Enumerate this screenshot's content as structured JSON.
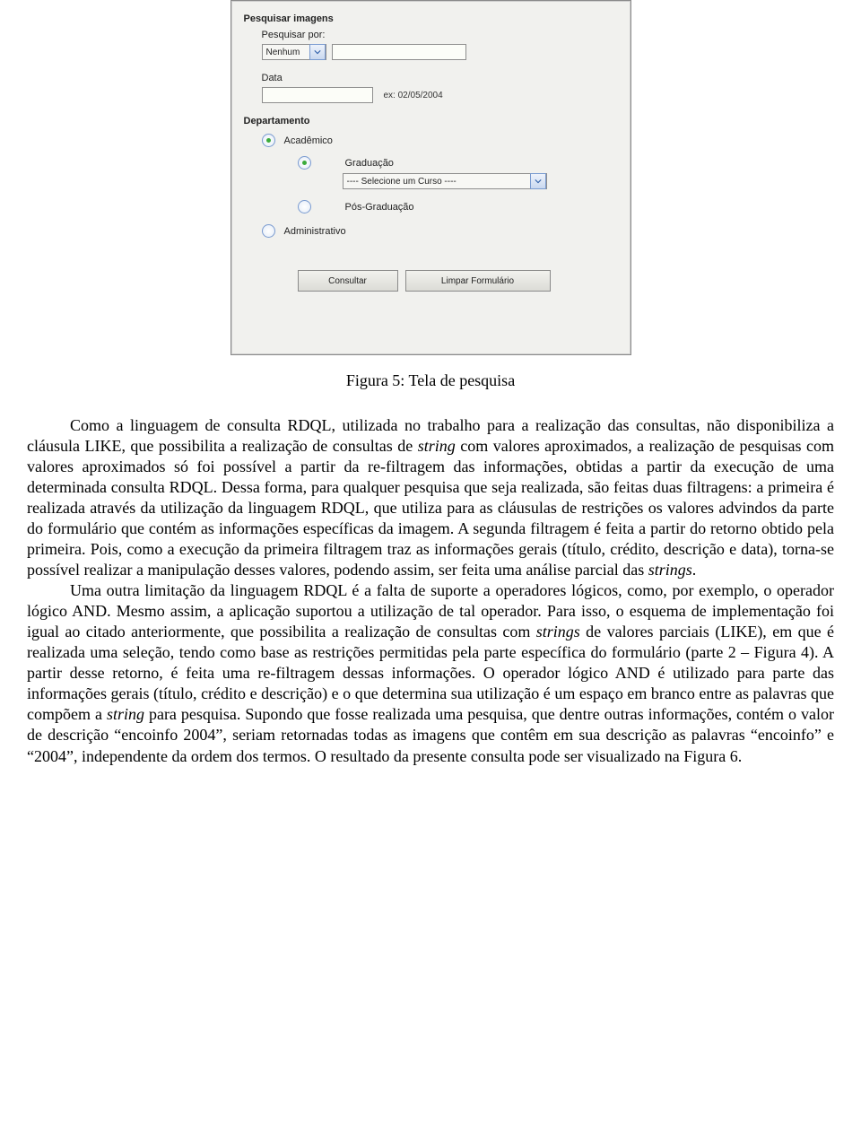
{
  "form": {
    "title": "Pesquisar imagens",
    "pesquisar_por_label": "Pesquisar por:",
    "pesquisar_por_value": "Nenhum",
    "data_label": "Data",
    "data_value": "",
    "data_hint": "ex: 02/05/2004",
    "departamento_label": "Departamento",
    "radios": {
      "academico": {
        "label": "Acadêmico",
        "selected": true
      },
      "graduacao": {
        "label": "Graduação",
        "selected": true
      },
      "curso_select_value": "---- Selecione um Curso ----",
      "pos_graduacao": {
        "label": "Pós-Graduação",
        "selected": false
      },
      "administrativo": {
        "label": "Administrativo",
        "selected": false
      }
    },
    "buttons": {
      "consultar": "Consultar",
      "limpar": "Limpar Formulário"
    }
  },
  "caption": "Figura 5: Tela de pesquisa",
  "paragraphs": {
    "p1a": "Como a linguagem de consulta RDQL, utilizada no trabalho para a realização das consultas, não disponibiliza a cláusula LIKE, que possibilita a realização de consultas de ",
    "p1b": " com valores aproximados, a realização de pesquisas com valores aproximados só foi possível a partir da re-filtragem das informações, obtidas a partir da execução de uma determinada consulta RDQL. Dessa forma, para qualquer pesquisa que seja realizada, são feitas duas filtragens: a primeira é realizada através da utilização da linguagem RDQL, que utiliza para as cláusulas de restrições os valores advindos da parte do formulário que contém as informações específicas da imagem. A segunda filtragem é feita a partir do retorno obtido pela primeira. Pois, como a execução da primeira filtragem traz as informações gerais (título, crédito, descrição e data), torna-se possível realizar a manipulação desses valores, podendo assim, ser feita uma análise parcial das ",
    "p1_string": "string",
    "p1_strings": "strings",
    "p1c": ".",
    "p2a": "Uma outra limitação da linguagem RDQL é a falta de suporte a operadores lógicos, como, por exemplo, o operador lógico AND. Mesmo assim, a aplicação suportou a utilização de tal operador. Para isso, o esquema de implementação foi igual ao citado anteriormente, que possibilita a realização de consultas com ",
    "p2_strings": "strings",
    "p2b": " de valores parciais (LIKE), em que é realizada uma seleção, tendo como base as restrições permitidas pela parte específica do formulário (parte 2 – Figura 4). A partir desse retorno, é feita uma re-filtragem dessas informações. O operador lógico AND é utilizado para parte das informações gerais (título, crédito e descrição) e o que determina sua utilização é um espaço em branco entre as palavras que compõem a ",
    "p2_string": "string",
    "p2c": " para pesquisa. Supondo que fosse realizada uma pesquisa, que dentre outras informações, contém o valor de descrição “encoinfo 2004”, seriam retornadas todas as imagens que contêm em sua descrição as palavras “encoinfo” e “2004”, independente da ordem dos termos. O resultado da presente consulta pode ser visualizado na Figura 6."
  }
}
